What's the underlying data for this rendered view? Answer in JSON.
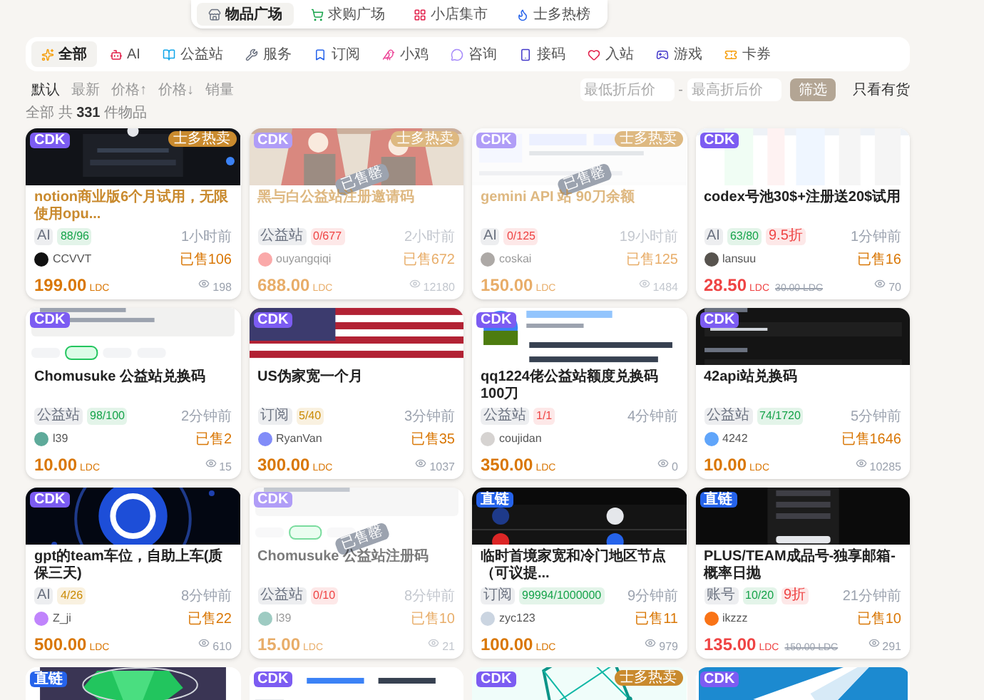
{
  "top_tabs": [
    {
      "label": "物品广场",
      "selected": true
    },
    {
      "label": "求购广场",
      "selected": false
    },
    {
      "label": "小店集市",
      "selected": false
    },
    {
      "label": "士多热榜",
      "selected": false
    }
  ],
  "categories": [
    {
      "label": "全部",
      "selected": true
    },
    {
      "label": "AI",
      "selected": false
    },
    {
      "label": "公益站",
      "selected": false
    },
    {
      "label": "服务",
      "selected": false
    },
    {
      "label": "订阅",
      "selected": false
    },
    {
      "label": "小鸡",
      "selected": false
    },
    {
      "label": "咨询",
      "selected": false
    },
    {
      "label": "接码",
      "selected": false
    },
    {
      "label": "入站",
      "selected": false
    },
    {
      "label": "游戏",
      "selected": false
    },
    {
      "label": "卡券",
      "selected": false
    }
  ],
  "sort_options": [
    {
      "label": "默认",
      "selected": true
    },
    {
      "label": "最新",
      "selected": false
    },
    {
      "label": "价格↑",
      "selected": false
    },
    {
      "label": "价格↓",
      "selected": false
    },
    {
      "label": "销量",
      "selected": false
    }
  ],
  "price_filter": {
    "min_placeholder": "最低折后价",
    "separator": "-",
    "max_placeholder": "最高折后价",
    "button": "筛选",
    "in_stock_label": "只看有货"
  },
  "count": {
    "prefix": "全部 共",
    "number": "331",
    "suffix": "件物品"
  },
  "cards": [
    {
      "badge": "CDK",
      "kind": "cdk",
      "hot": true,
      "hot_tag": "士多热卖",
      "sold_out": false,
      "title": "notion商业版6个月试用，无限使用opu...",
      "tags": [
        {
          "text": "AI",
          "color": "#6b7280"
        },
        {
          "text": "88/96",
          "color": "#16a34a"
        }
      ],
      "time": "1小时前",
      "seller": "CCVVT",
      "sold": "已售106",
      "price": "199.00",
      "unit": "LDC",
      "views": "198"
    },
    {
      "badge": "CDK",
      "kind": "cdk",
      "hot": true,
      "hot_tag": "士多热卖",
      "sold_out": true,
      "stamp": "已售罄",
      "title": "黑与白公益站注册邀请码",
      "tags": [
        {
          "text": "公益站",
          "color": "#6b7280"
        },
        {
          "text": "0/677",
          "color": "#ef4444"
        }
      ],
      "time": "2小时前",
      "seller": "ouyangqiqi",
      "sold": "已售672",
      "price": "688.00",
      "unit": "LDC",
      "views": "12180"
    },
    {
      "badge": "CDK",
      "kind": "cdk",
      "hot": true,
      "hot_tag": "士多热卖",
      "sold_out": true,
      "stamp": "已售罄",
      "title": "gemini API 站 90刀余额",
      "tags": [
        {
          "text": "AI",
          "color": "#6b7280"
        },
        {
          "text": "0/125",
          "color": "#ef4444"
        }
      ],
      "time": "19小时前",
      "seller": "coskai",
      "sold": "已售125",
      "price": "150.00",
      "unit": "LDC",
      "views": "1484"
    },
    {
      "badge": "CDK",
      "kind": "cdk",
      "hot": false,
      "sold_out": false,
      "title": "codex号池30$+注册送20$试用",
      "tags": [
        {
          "text": "AI",
          "color": "#6b7280"
        },
        {
          "text": "63/80",
          "color": "#16a34a"
        },
        {
          "text": "9.5折",
          "color": "#ef4444"
        }
      ],
      "time": "1分钟前",
      "seller": "lansuu",
      "sold": "已售16",
      "price": "28.50",
      "unit": "LDC",
      "original_price": "30.00 LDC",
      "views": "70"
    },
    {
      "badge": "CDK",
      "kind": "cdk",
      "hot": false,
      "sold_out": false,
      "title": "Chomusuke 公益站兑换码",
      "tags": [
        {
          "text": "公益站",
          "color": "#6b7280"
        },
        {
          "text": "98/100",
          "color": "#16a34a"
        }
      ],
      "time": "2分钟前",
      "seller": "l39",
      "sold": "已售2",
      "price": "10.00",
      "unit": "LDC",
      "views": "15"
    },
    {
      "badge": "CDK",
      "kind": "cdk",
      "hot": false,
      "sold_out": false,
      "title": "US伪家宽一个月",
      "tags": [
        {
          "text": "订阅",
          "color": "#6b7280"
        },
        {
          "text": "5/40",
          "color": "#ca8a04"
        }
      ],
      "time": "3分钟前",
      "seller": "RyanVan",
      "sold": "已售35",
      "price": "300.00",
      "unit": "LDC",
      "views": "1037"
    },
    {
      "badge": "CDK",
      "kind": "cdk",
      "hot": false,
      "sold_out": false,
      "title": "qq1224佬公益站额度兑换码 100刀",
      "tags": [
        {
          "text": "公益站",
          "color": "#6b7280"
        },
        {
          "text": "1/1",
          "color": "#ef4444"
        }
      ],
      "time": "4分钟前",
      "seller": "coujidan",
      "price": "350.00",
      "unit": "LDC",
      "views": "0"
    },
    {
      "badge": "CDK",
      "kind": "cdk",
      "hot": false,
      "sold_out": false,
      "title": "42api站兑换码",
      "tags": [
        {
          "text": "公益站",
          "color": "#6b7280"
        },
        {
          "text": "74/1720",
          "color": "#16a34a"
        }
      ],
      "time": "5分钟前",
      "seller": "4242",
      "sold": "已售1646",
      "price": "10.00",
      "unit": "LDC",
      "views": "10285"
    },
    {
      "badge": "CDK",
      "kind": "cdk",
      "hot": false,
      "sold_out": false,
      "title": "gpt的team车位，自助上车(质保三天)",
      "tags": [
        {
          "text": "AI",
          "color": "#6b7280"
        },
        {
          "text": "4/26",
          "color": "#ca8a04"
        }
      ],
      "time": "8分钟前",
      "seller": "Z_ji",
      "sold": "已售22",
      "price": "500.00",
      "unit": "LDC",
      "views": "610"
    },
    {
      "badge": "CDK",
      "kind": "cdk",
      "hot": false,
      "sold_out": true,
      "stamp": "已售罄",
      "title": "Chomusuke 公益站注册码",
      "tags": [
        {
          "text": "公益站",
          "color": "#6b7280"
        },
        {
          "text": "0/10",
          "color": "#ef4444"
        }
      ],
      "time": "8分钟前",
      "seller": "l39",
      "sold": "已售10",
      "price": "15.00",
      "unit": "LDC",
      "views": "21"
    },
    {
      "badge": "直链",
      "kind": "direct",
      "hot": false,
      "sold_out": false,
      "title": "临时首境家宽和冷门地区节点（可议提...",
      "tags": [
        {
          "text": "订阅",
          "color": "#6b7280"
        },
        {
          "text": "99994/1000000",
          "color": "#16a34a"
        }
      ],
      "time": "9分钟前",
      "seller": "zyc123",
      "sold": "已售11",
      "price": "100.00",
      "unit": "LDC",
      "views": "979"
    },
    {
      "badge": "直链",
      "kind": "direct",
      "hot": false,
      "sold_out": false,
      "title": "PLUS/TEAM成品号-独享邮箱-概率日抛",
      "tags": [
        {
          "text": "账号",
          "color": "#6b7280"
        },
        {
          "text": "10/20",
          "color": "#16a34a"
        },
        {
          "text": "9折",
          "color": "#ef4444"
        }
      ],
      "time": "21分钟前",
      "seller": "ikzzz",
      "sold": "已售10",
      "price": "135.00",
      "unit": "LDC",
      "original_price": "150.00 LDC",
      "views": "291"
    }
  ],
  "partial_cards": [
    {
      "badge": "直链",
      "kind": "direct"
    },
    {
      "badge": "CDK",
      "kind": "cdk"
    },
    {
      "badge": "CDK",
      "kind": "cdk",
      "hot_tag": "士多热卖"
    },
    {
      "badge": "CDK",
      "kind": "cdk"
    }
  ]
}
